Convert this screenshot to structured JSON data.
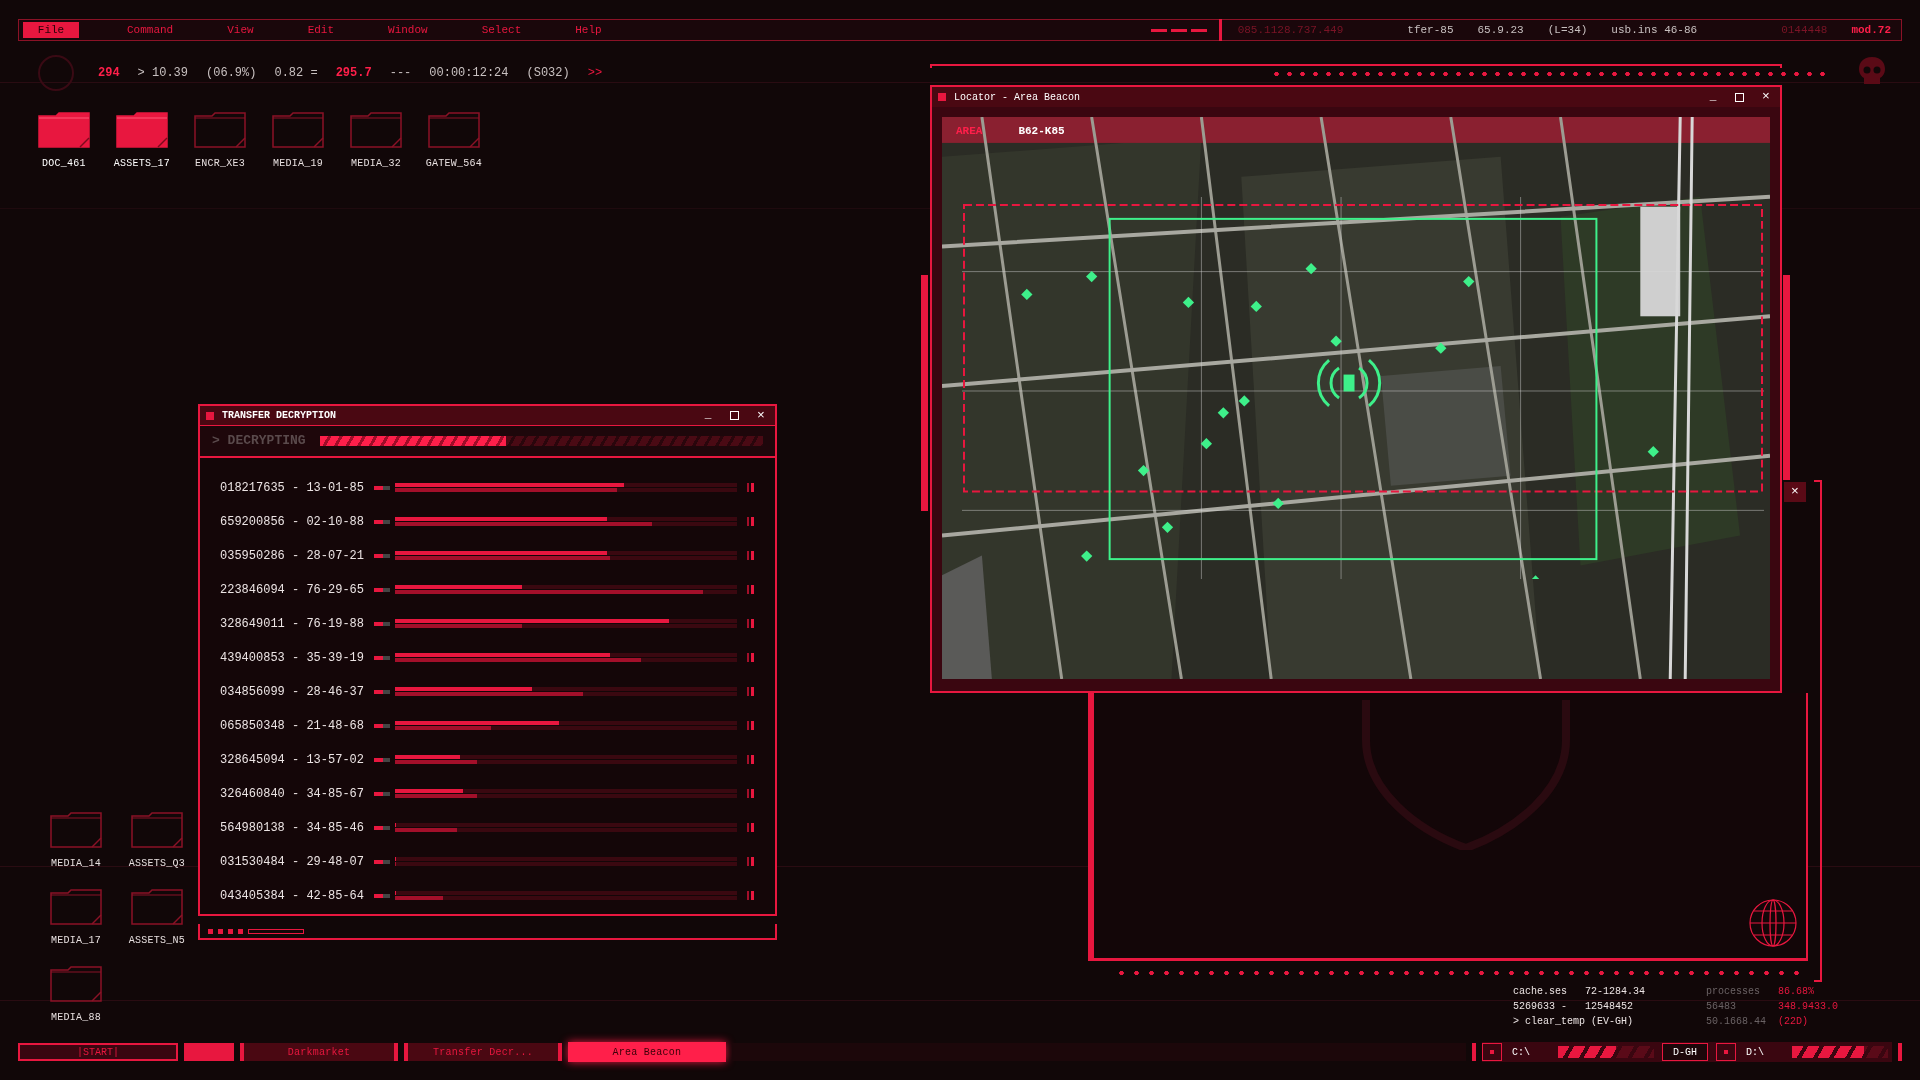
{
  "menu_bar": {
    "items": [
      {
        "label": "File",
        "selected": true
      },
      {
        "label": "Command",
        "selected": false
      },
      {
        "label": "View",
        "selected": false
      },
      {
        "label": "Edit",
        "selected": false
      },
      {
        "label": "Window",
        "selected": false
      },
      {
        "label": "Select",
        "selected": false
      },
      {
        "label": "Help",
        "selected": false
      }
    ],
    "readouts": [
      {
        "text": "085.1128.737.449",
        "kind": "dim"
      },
      {
        "text": "tfer-85",
        "kind": "normal"
      },
      {
        "text": "65.9.23",
        "kind": "normal"
      },
      {
        "text": "(L=34)",
        "kind": "normal"
      },
      {
        "text": "usb.ins 46-86",
        "kind": "normal"
      },
      {
        "text": "0144448",
        "kind": "dim"
      },
      {
        "text": "mod.72",
        "kind": "alert"
      }
    ]
  },
  "stats": [
    {
      "text": "294",
      "kind": "alert"
    },
    {
      "text": "> 10.39",
      "kind": "normal"
    },
    {
      "text": "(06.9%)",
      "kind": "normal"
    },
    {
      "text": "0.82 =",
      "kind": "normal"
    },
    {
      "text": "295.7",
      "kind": "alert"
    },
    {
      "text": "---",
      "kind": "normal"
    },
    {
      "text": "00:00:12:24",
      "kind": "normal"
    },
    {
      "text": "(S032)",
      "kind": "normal"
    },
    {
      "text": ">>",
      "kind": "accent"
    }
  ],
  "desktop_icons": [
    {
      "label": "DOC_461",
      "selected": true
    },
    {
      "label": "ASSETS_17",
      "selected": true
    },
    {
      "label": "ENCR_XE3",
      "selected": false
    },
    {
      "label": "MEDIA_19",
      "selected": false
    },
    {
      "label": "MEDIA_32",
      "selected": false
    },
    {
      "label": "GATEW_564",
      "selected": false
    }
  ],
  "lower_icons": [
    {
      "label": "MEDIA_14",
      "selected": false
    },
    {
      "label": "ASSETS_Q3",
      "selected": false
    },
    {
      "label": "MEDIA_17",
      "selected": false
    },
    {
      "label": "ASSETS_N5",
      "selected": false
    },
    {
      "label": "MEDIA_88",
      "selected": false
    }
  ],
  "transfer_window": {
    "title": "TRANSFER DECRYPTION",
    "controls": [
      "_",
      "×"
    ],
    "status": "> DECRYPTING",
    "level": 0.42,
    "rows": [
      {
        "label": "018217635 - 13-01-85",
        "bars": [
          {
            "level": 0.67
          },
          {
            "level": 0.65
          }
        ]
      },
      {
        "label": "659200856 - 02-10-88",
        "bars": [
          {
            "level": 0.62
          },
          {
            "level": 0.75
          }
        ]
      },
      {
        "label": "035950286 - 28-07-21",
        "bars": [
          {
            "level": 0.62
          },
          {
            "level": 0.63
          }
        ]
      },
      {
        "label": "223846094 - 76-29-65",
        "bars": [
          {
            "level": 0.37
          },
          {
            "level": 0.9
          }
        ]
      },
      {
        "label": "328649011 - 76-19-88",
        "bars": [
          {
            "level": 0.8
          },
          {
            "level": 0.37
          }
        ]
      },
      {
        "label": "439400853 - 35-39-19",
        "bars": [
          {
            "level": 0.63
          },
          {
            "level": 0.72
          }
        ]
      },
      {
        "label": "034856099 - 28-46-37",
        "bars": [
          {
            "level": 0.4
          },
          {
            "level": 0.55
          }
        ]
      },
      {
        "label": "065850348 - 21-48-68",
        "bars": [
          {
            "level": 0.48
          },
          {
            "level": 0.28
          }
        ]
      },
      {
        "label": "328645094 - 13-57-02",
        "bars": [
          {
            "level": 0.19
          },
          {
            "level": 0.24
          }
        ]
      },
      {
        "label": "326460840 - 34-85-67",
        "bars": [
          {
            "level": 0.2
          },
          {
            "level": 0.24
          }
        ]
      },
      {
        "label": "564980138 - 34-85-46",
        "bars": [
          {
            "level": 0
          },
          {
            "level": 0.18
          }
        ]
      },
      {
        "label": "031530484 - 29-48-07",
        "bars": [
          {
            "level": 0
          },
          {
            "level": 0
          }
        ]
      },
      {
        "label": "043405384 - 42-85-64",
        "bars": [
          {
            "level": 0
          },
          {
            "level": 0.14
          }
        ]
      }
    ]
  },
  "locator_window": {
    "title": "Locator - Area Beacon",
    "controls": [
      "_",
      "×"
    ],
    "side_close": "×",
    "map_labels": [
      {
        "text": "AREA",
        "kind": "alert"
      },
      {
        "text": "B62-K85",
        "kind": "normal"
      }
    ]
  },
  "status": {
    "left": [
      {
        "name": "cache.ses",
        "value": "72-1284.34"
      },
      {
        "name": "5269633 -",
        "value": "12548452"
      },
      {
        "name": "> clear_temp (EV-GH)"
      }
    ],
    "right": [
      {
        "name": "processes",
        "value": "86.68%"
      },
      {
        "name": "56483",
        "value": "348.9433.0"
      },
      {
        "name": "50.1668.44",
        "value": "(22D)"
      }
    ]
  },
  "taskbar": {
    "start": "|START|",
    "tasks": [
      {
        "label": "Darkmarket",
        "selected": false
      },
      {
        "label": "Transfer Decr...",
        "selected": false
      },
      {
        "label": "Area Beacon",
        "selected": true
      }
    ],
    "drives": [
      {
        "kind": "drive",
        "label": "C:\\",
        "level": 0.6
      },
      {
        "kind": "tag",
        "label": "D-GH"
      },
      {
        "kind": "drive",
        "label": "D:\\",
        "level": 0.75
      }
    ]
  }
}
